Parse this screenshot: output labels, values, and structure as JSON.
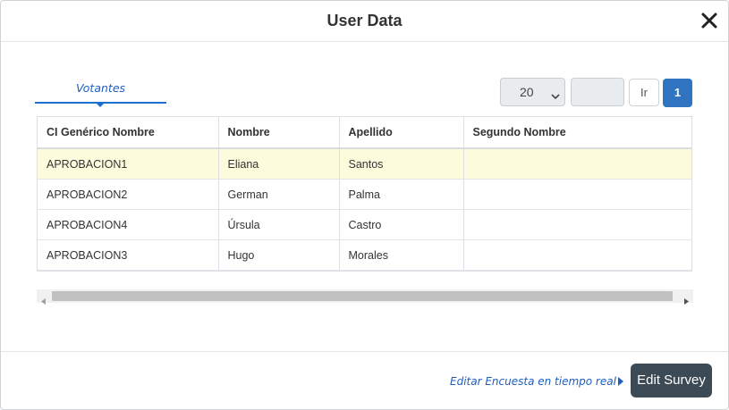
{
  "dialog": {
    "title": "User Data",
    "close_icon": "close-icon"
  },
  "tab": {
    "label": "Votantes"
  },
  "pager": {
    "page_size": "20",
    "page_size_options": [
      "20"
    ],
    "goto_value": "",
    "go_label": "Ir",
    "current_page": "1",
    "accent_color": "#2f74c0"
  },
  "table": {
    "columns": [
      "CI Genérico Nombre",
      "Nombre",
      "Apellido",
      "Segundo Nombre"
    ],
    "rows": [
      [
        "APROBACION1",
        "Eliana",
        "Santos",
        ""
      ],
      [
        "APROBACION2",
        "German",
        "Palma",
        ""
      ],
      [
        "APROBACION4",
        "Úrsula",
        "Castro",
        ""
      ],
      [
        "APROBACION3",
        "Hugo",
        "Morales",
        ""
      ]
    ],
    "selected_row_color": "#fcfbdc"
  },
  "footer": {
    "link_label": "Editar Encuesta en tiempo real",
    "edit_button_label": "Edit Survey"
  }
}
